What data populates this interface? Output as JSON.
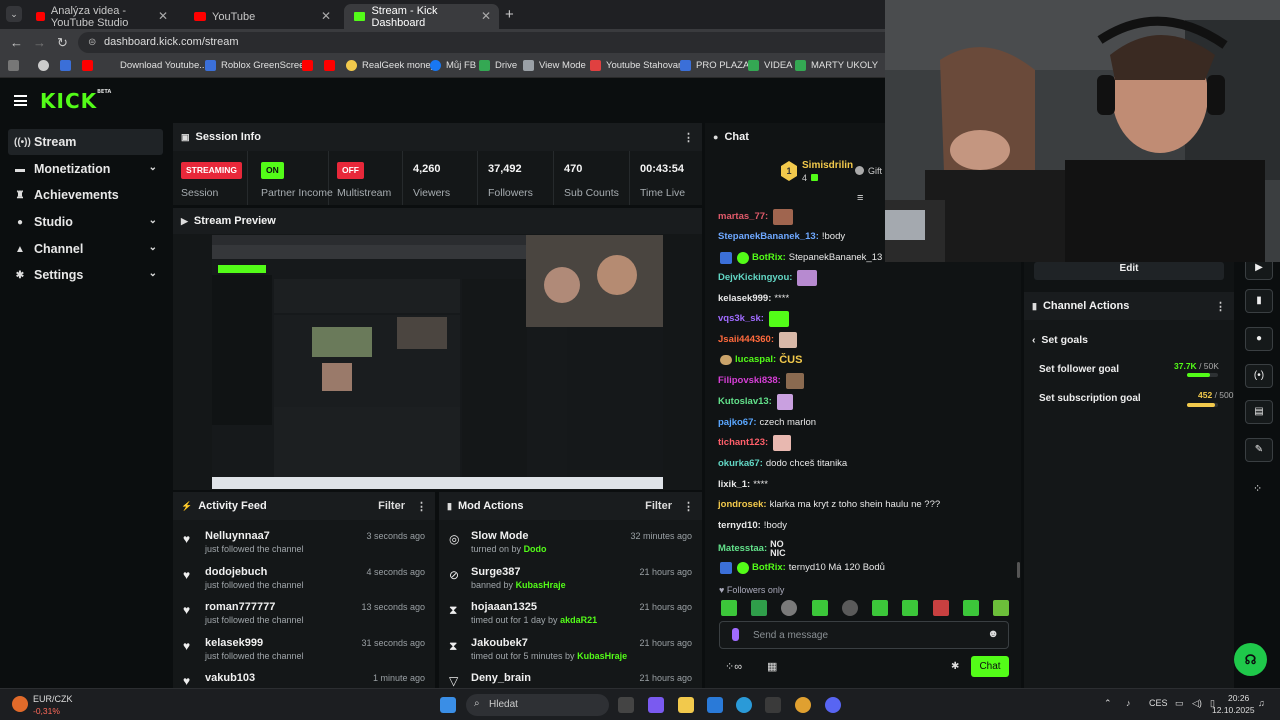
{
  "browser": {
    "tabs": [
      {
        "label": "Analýza videa - YouTube Studio"
      },
      {
        "label": "YouTube"
      },
      {
        "label": "Stream - Kick Dashboard"
      }
    ],
    "url": "dashboard.kick.com/stream",
    "bookmarks": [
      "Download Youtube...",
      "Roblox GreenScreen",
      "RealGeek money",
      "Můj FB",
      "Drive",
      "View Mode",
      "Youtube Stahovaní",
      "PRO PLAZA",
      "VIDEA",
      "MARTY UKOLY"
    ]
  },
  "app": {
    "logo": "KICK",
    "logo_beta": "BETA"
  },
  "sidebar": {
    "items": [
      {
        "label": "Stream",
        "active": true
      },
      {
        "label": "Monetization"
      },
      {
        "label": "Achievements"
      },
      {
        "label": "Studio"
      },
      {
        "label": "Channel"
      },
      {
        "label": "Settings"
      }
    ]
  },
  "session": {
    "title": "Session Info",
    "stats": [
      {
        "badge": "STREAMING",
        "label": "Session"
      },
      {
        "badge": "ON",
        "label": "Partner Income"
      },
      {
        "badge": "OFF",
        "label": "Multistream"
      },
      {
        "value": "4,260",
        "label": "Viewers"
      },
      {
        "value": "37,492",
        "label": "Followers"
      },
      {
        "value": "470",
        "label": "Sub Counts"
      },
      {
        "value": "00:43:54",
        "label": "Time Live"
      }
    ]
  },
  "preview": {
    "title": "Stream Preview"
  },
  "activity": {
    "title": "Activity Feed",
    "filter": "Filter",
    "items": [
      {
        "name": "Nelluynnaa7",
        "sub": "just followed the channel",
        "time": "3 seconds ago"
      },
      {
        "name": "dodojebuch",
        "sub": "just followed the channel",
        "time": "4 seconds ago"
      },
      {
        "name": "roman777777",
        "sub": "just followed the channel",
        "time": "13 seconds ago"
      },
      {
        "name": "kelasek999",
        "sub": "just followed the channel",
        "time": "31 seconds ago"
      },
      {
        "name": "vakub103",
        "sub": "",
        "time": "1 minute ago"
      }
    ]
  },
  "mod": {
    "title": "Mod Actions",
    "filter": "Filter",
    "items": [
      {
        "name": "Slow Mode",
        "sub": "turned on by",
        "by": "Dodo",
        "time": "32 minutes ago"
      },
      {
        "name": "Surge387",
        "sub": "banned by",
        "by": "KubasHraje",
        "time": "21 hours ago"
      },
      {
        "name": "hojaaan1325",
        "sub": "timed out for 1 day by",
        "by": "akdaR21",
        "time": "21 hours ago"
      },
      {
        "name": "Jakoubek7",
        "sub": "timed out for 5 minutes by",
        "by": "KubasHraje",
        "time": "21 hours ago"
      },
      {
        "name": "Deny_brain",
        "sub": "",
        "by": "",
        "time": "21 hours ago"
      }
    ]
  },
  "chat": {
    "title": "Chat",
    "gifter": {
      "name": "Simisdrilin",
      "count": "4",
      "rank": "1",
      "gift": "Gift"
    },
    "messages": [
      {
        "user": "martas_77:",
        "color": "#e05a6a",
        "text": ""
      },
      {
        "user": "StepanekBananek_13:",
        "color": "#6ea8ff",
        "text": "!body"
      },
      {
        "user": "BotRix:",
        "color": "#53fc18",
        "text": "StepanekBananek_13 Má 5"
      },
      {
        "user": "DejvKickingyou:",
        "color": "#62d6c4",
        "text": ""
      },
      {
        "user": "kelasek999:",
        "color": "#e8e8e8",
        "text": "****"
      },
      {
        "user": "vqs3k_sk:",
        "color": "#a06bff",
        "text": ""
      },
      {
        "user": "Jsaii444360:",
        "color": "#ff6a3d",
        "text": ""
      },
      {
        "user": "lucaspal:",
        "color": "#53fc18",
        "text": "ČUS"
      },
      {
        "user": "Filipovski838:",
        "color": "#d63fd6",
        "text": ""
      },
      {
        "user": "Kutoslav13:",
        "color": "#62e08a",
        "text": ""
      },
      {
        "user": "pajko67:",
        "color": "#5aa7ff",
        "text": "czech marlon"
      },
      {
        "user": "tichant123:",
        "color": "#ff5f6a",
        "text": ""
      },
      {
        "user": "okurka67:",
        "color": "#62d6c4",
        "text": "dodo chceš titanika"
      },
      {
        "user": "lixik_1:",
        "color": "#e8e8e8",
        "text": "****"
      },
      {
        "user": "jondrosek:",
        "color": "#f2c94c",
        "text": "klarka ma kryt z toho shein haulu ne ???"
      },
      {
        "user": "ternyd10:",
        "color": "#e8e8e8",
        "text": "!body"
      },
      {
        "user": "Matesstaa:",
        "color": "#62e08a",
        "text": "NO NIC"
      },
      {
        "user": "BotRix:",
        "color": "#53fc18",
        "text": "ternyd10 Má 120 Bodů"
      }
    ],
    "followers_only": "Followers only",
    "placeholder": "Send a message",
    "send_label": "Chat"
  },
  "edit_label": "Edit",
  "channel_actions": {
    "title": "Channel Actions",
    "back_label": "Set goals",
    "goals": [
      {
        "label": "Set follower goal",
        "value": "37.7K",
        "target": "/ 50K",
        "progress": 0.754,
        "color": "#53fc18"
      },
      {
        "label": "Set subscription goal",
        "value": "452",
        "target": "/ 500",
        "progress": 0.904,
        "color": "#f2c94c"
      }
    ]
  },
  "taskbar": {
    "ticker": "EUR/CZK",
    "ticker_change": "-0,31%",
    "search": "Hledat",
    "lang": "CES",
    "time": "20:26",
    "date": "12.10.2025"
  }
}
